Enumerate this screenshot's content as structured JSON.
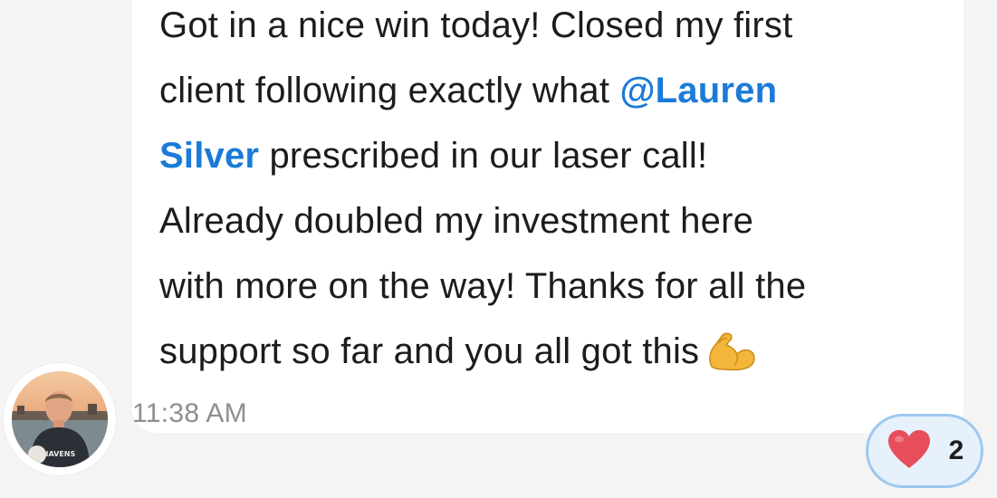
{
  "message": {
    "lines": [
      "Got in a nice win today! Closed my first",
      "client following exactly what ",
      "@Lauren",
      "Silver",
      " prescribed in our laser call!",
      "Already doubled my investment here",
      "with more on the way! Thanks for all the",
      "support so far and you all got this"
    ],
    "timestamp": "11:38 AM"
  },
  "avatar": {
    "shirt_text": "HAVENS"
  },
  "reaction": {
    "icon": "heart-icon",
    "count": "2"
  },
  "emoji": {
    "icon": "flexed-biceps-icon"
  },
  "colors": {
    "mention": "#1a7bd8",
    "reaction_bg": "#e6f1fc",
    "reaction_border": "#9cc8f0",
    "heart": "#e64e5b"
  }
}
